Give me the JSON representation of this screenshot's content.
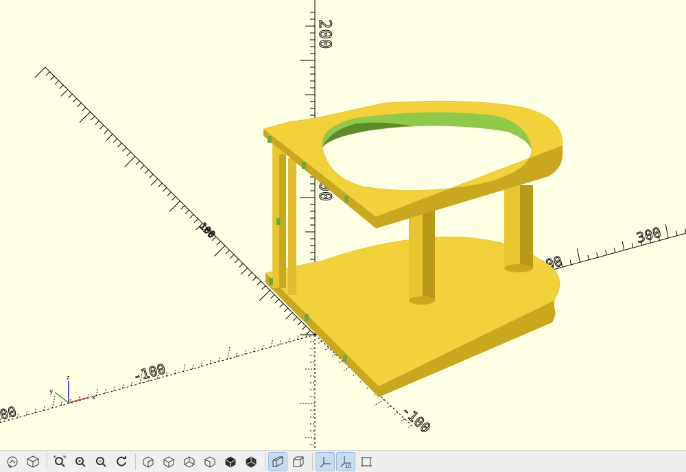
{
  "viewport": {
    "background": "#ffffe5",
    "model_color": "#f2d13b",
    "axis_labels": {
      "z_200": "200",
      "z_100": "100",
      "x_300": "300",
      "x_200": "200",
      "x_neg_100": "-100",
      "y_100": "100",
      "y_neg_100": "-100"
    },
    "gizmo": {
      "x": "x",
      "y": "y",
      "z": "z"
    }
  },
  "toolbar": {
    "buttons": [
      {
        "icon": "preview-icon",
        "active": false
      },
      {
        "icon": "render-icon",
        "active": false
      },
      {
        "icon": "view-all-icon",
        "active": false
      },
      {
        "icon": "zoom-in-icon",
        "active": false
      },
      {
        "icon": "zoom-out-icon",
        "active": false
      },
      {
        "icon": "reset-view-icon",
        "active": false
      },
      {
        "icon": "view-right-icon",
        "active": false
      },
      {
        "icon": "view-top-icon",
        "active": false
      },
      {
        "icon": "view-bottom-icon",
        "active": false
      },
      {
        "icon": "view-left-icon",
        "active": false
      },
      {
        "icon": "view-front-icon",
        "active": false
      },
      {
        "icon": "view-back-icon",
        "active": false
      },
      {
        "icon": "perspective-icon",
        "active": true
      },
      {
        "icon": "orthogonal-icon",
        "active": false
      },
      {
        "icon": "show-axes-icon",
        "active": true
      },
      {
        "icon": "show-scale-markers-icon",
        "active": true
      },
      {
        "icon": "show-edges-icon",
        "active": false
      }
    ],
    "scale_marker_label": "10"
  }
}
